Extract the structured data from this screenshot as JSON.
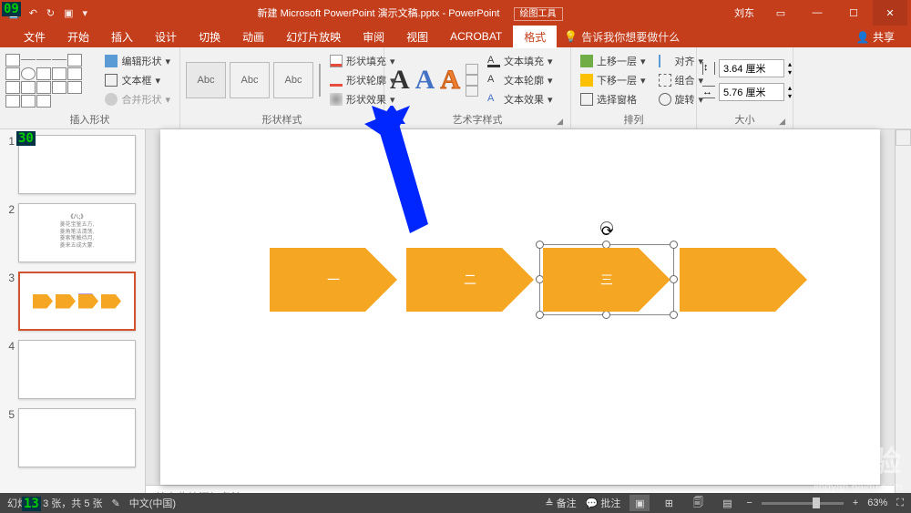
{
  "titlebar": {
    "title": "新建 Microsoft PowerPoint 演示文稿.pptx - PowerPoint",
    "context_tab": "绘图工具",
    "user": "刘东"
  },
  "tabs": {
    "file": "文件",
    "home": "开始",
    "insert": "插入",
    "design": "设计",
    "transitions": "切换",
    "animations": "动画",
    "slideshow": "幻灯片放映",
    "review": "审阅",
    "view": "视图",
    "acrobat": "ACROBAT",
    "format": "格式",
    "tell_me": "告诉我你想要做什么",
    "share": "共享"
  },
  "ribbon": {
    "insert_shapes": {
      "label": "插入形状",
      "edit_shape": "编辑形状",
      "text_box": "文本框",
      "merge_shapes": "合并形状"
    },
    "shape_styles": {
      "label": "形状样式",
      "thumb_text": "Abc",
      "fill": "形状填充",
      "outline": "形状轮廓",
      "effects": "形状效果"
    },
    "wordart_styles": {
      "label": "艺术字样式",
      "text_fill": "文本填充",
      "text_outline": "文本轮廓",
      "text_effects": "文本效果"
    },
    "arrange": {
      "label": "排列",
      "bring_forward": "上移一层",
      "send_backward": "下移一层",
      "selection_pane": "选择窗格",
      "align": "对齐",
      "group": "组合",
      "rotate": "旋转"
    },
    "size": {
      "label": "大小",
      "height": "3.64 厘米",
      "width": "5.76 厘米"
    }
  },
  "thumbs": {
    "slide2": {
      "title": "《八;》",
      "line1": "菱花宝鉴五方,",
      "line2": "菱角笔法清荡,",
      "line3": "菱索笔触待月,",
      "line4": "菱来五成大蒙."
    }
  },
  "slide": {
    "shape1": "一",
    "shape2": "二",
    "shape3": "三",
    "shape4": ""
  },
  "notes": {
    "placeholder": "单击此处添加备注"
  },
  "status": {
    "slide_info_prefix": "幻灯",
    "slide_info": "第 3 张，共 5 张",
    "lang_label": "中文(中国)",
    "notes_btn": "备注",
    "comments_btn": "批注",
    "zoom": "63%"
  },
  "watermark": {
    "brand": "Baid 经验",
    "url": "jingyan.baidu.com"
  },
  "badges": {
    "tl": "09",
    "thumbs": "30",
    "status": "13"
  }
}
